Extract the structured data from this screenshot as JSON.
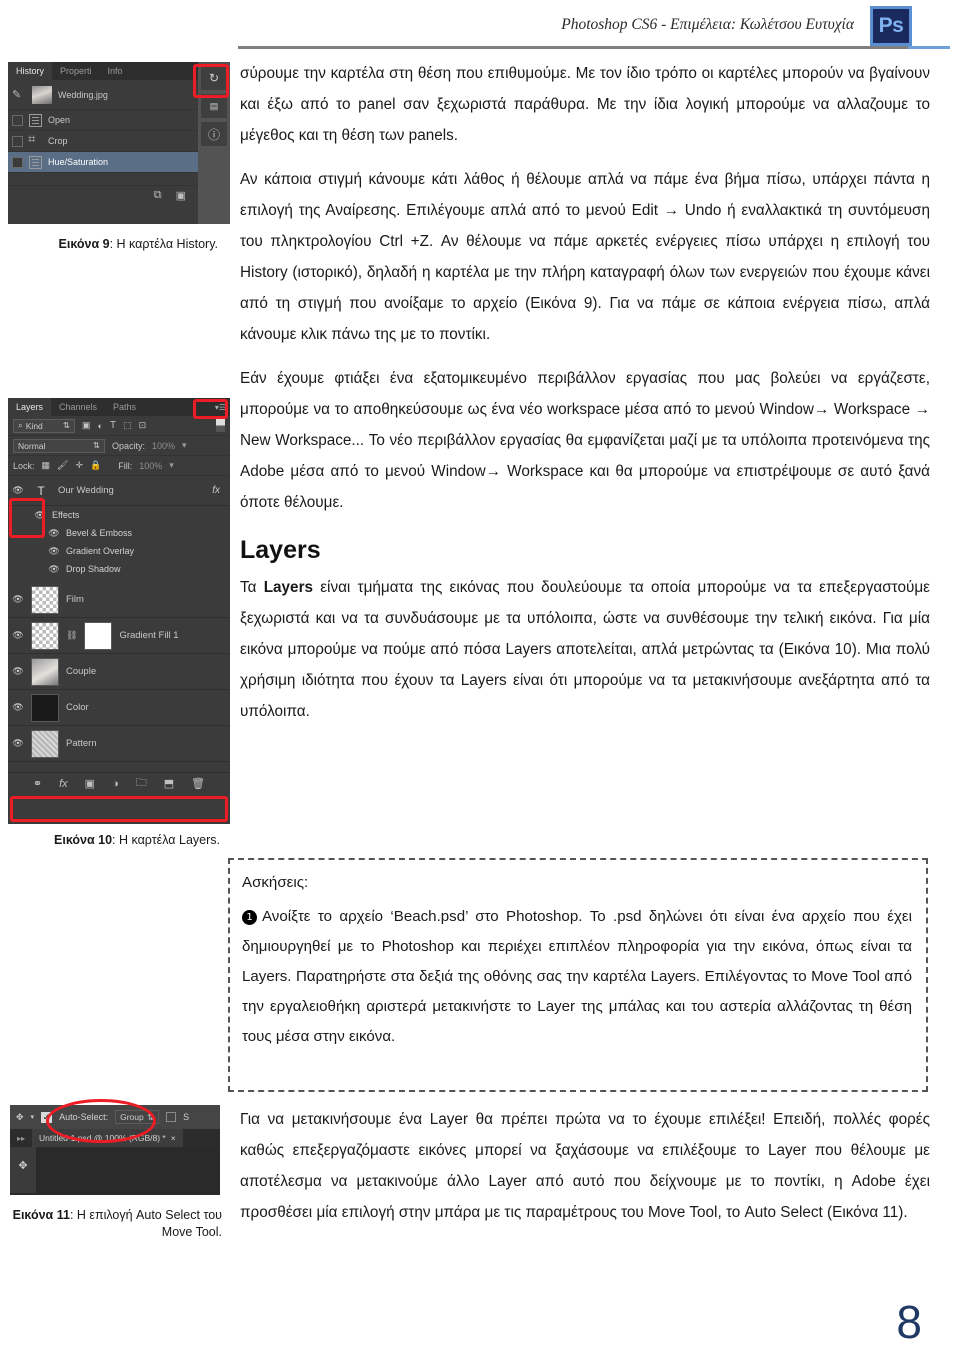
{
  "header": {
    "title": "Photoshop CS6 - Επιμέλεια: Κωλέτσου Ευτυχία",
    "logo_text": "Ps"
  },
  "page_number": "8",
  "main": {
    "paragraphs": [
      "σύρουμε την καρτέλα στη θέση που επιθυμούμε. Με τον ίδιο τρόπο οι καρτέλες μπορούν να βγαίνουν και έξω από το panel σαν ξεχωριστά παράθυρα. Με την ίδια λογική μπορούμε να αλλαζουμε το μέγεθος και τη θέση των panels.",
      "Αν κάποια στιγμή κάνουμε κάτι λάθος ή θέλουμε απλά να πάμε ένα βήμα πίσω, υπάρχει πάντα η επιλογή της Αναίρεσης. Επιλέγουμε απλά από το μενού Edit → Undo ή εναλλακτικά τη συντόμευση του πληκτρολογίου Ctrl +Z. Αν θέλουμε να πάμε αρκετές ενέργειες πίσω υπάρχει η επιλογή του History (ιστορικό), δηλαδή η καρτέλα με την πλήρη καταγραφή όλων των ενεργειών που έχουμε κάνει από τη στιγμή που ανοίξαμε το αρχείο (Εικόνα 9). Για να πάμε σε κάποια ενέργεια πίσω, απλά κάνουμε κλικ πάνω της με το ποντίκι.",
      "Εάν έχουμε φτιάξει ένα εξατομικευμένο περιβάλλον εργασίας που μας βολεύει να εργάζεστε, μπορούμε να το αποθηκεύσουμε ως ένα νέο workspace μέσα από το μενού Window→ Workspace → New Workspace... Το νέο περιβάλλον εργασίας θα εμφανίζεται μαζί με τα υπόλοιπα προτεινόμενα της Adobe μέσα από το μενού Window→ Workspace και θα μπορούμε να επιστρέψουμε σε αυτό ξανά όποτε θέλουμε."
    ],
    "layers_heading": "Layers",
    "layers_paragraph_pre": "Τα ",
    "layers_paragraph_bold": "Layers",
    "layers_paragraph_post": " είναι τμήματα της εικόνας που δουλεύουμε τα οποία μπορούμε να τα επεξεργαστούμε ξεχωριστά και να τα συνδυάσουμε με τα υπόλοιπα, ώστε να συνθέσουμε την τελική εικόνα. Για μία εικόνα μπορούμε να πούμε από πόσα Layers αποτελείται, απλά μετρώντας τα (Εικόνα 10). Μια πολύ χρήσιμη ιδιότητα που έχουν τα Layers είναι ότι μπορούμε να τα μετακινήσουμε ανεξάρτητα από τα υπόλοιπα.",
    "bottom_paragraph": "Για να μετακινήσουμε ένα Layer θα πρέπει πρώτα να το έχουμε επιλέξει! Επειδή, πολλές φορές καθώς επεξεργαζόμαστε εικόνες μπορεί να ξαχάσουμε να επιλέξουμε το Layer που θέλουμε με αποτέλεσμα να μετακινούμε άλλο Layer από αυτό που δείχνουμε με το ποντίκι, η Adobe έχει προσθέσει μία επιλογή στην μπάρα με τις παραμέτρους του Move Tool, το Auto Select (Εικόνα 11)."
  },
  "exercise": {
    "title": "Ασκήσεις:",
    "item_number": "❶",
    "item_text": "Ανοίξτε το αρχείο ‘Beach.psd’ στο Photoshop. Το .psd δηλώνει ότι είναι ένα αρχείο που έχει δημιουργηθεί με το Photoshop και περιέχει επιπλέον πληροφορία για την εικόνα, όπως είναι τα Layers. Παρατηρήστε στα δεξιά της οθόνης σας την καρτέλα Layers. Επιλέγοντας το Move Tool από την εργαλειοθήκη αριστερά μετακινήστε το Layer της μπάλας και του αστερία αλλάζοντας τη θέση τους μέσα στην εικόνα."
  },
  "figure9": {
    "tabs": [
      "History",
      "Properti",
      "Info"
    ],
    "rows": [
      {
        "label": "Wedding.jpg",
        "type": "thumb"
      },
      {
        "label": "Open",
        "type": "doc"
      },
      {
        "label": "Crop",
        "type": "crop"
      },
      {
        "label": "Hue/Saturation",
        "type": "doc",
        "selected": true
      }
    ],
    "footer_icons": [
      "new-snapshot-icon",
      "camera-icon",
      "trash-icon"
    ],
    "caption_bold": "Εικόνα 9",
    "caption_rest": ": Η καρτέλα History."
  },
  "figure10": {
    "tabs": [
      "Layers",
      "Channels",
      "Paths"
    ],
    "filter_label": "Kind",
    "filter_icons": [
      "image-icon",
      "adjustment-icon",
      "type-icon",
      "shape-icon",
      "smartobject-icon"
    ],
    "blend_mode": "Normal",
    "opacity_label": "Opacity:",
    "opacity_value": "100%",
    "lock_label": "Lock:",
    "fill_label": "Fill:",
    "fill_value": "100%",
    "layers": [
      {
        "name": "Our Wedding",
        "fx": "fx",
        "kind": "text"
      },
      {
        "name": "Film",
        "kind": "film"
      },
      {
        "name": "Gradient Fill 1",
        "kind": "gradient"
      },
      {
        "name": "Couple",
        "kind": "photo"
      },
      {
        "name": "Color",
        "kind": "solid"
      },
      {
        "name": "Pattern",
        "kind": "pattern"
      }
    ],
    "effects": [
      {
        "name": "Effects",
        "level": 0
      },
      {
        "name": "Bevel & Emboss",
        "level": 1
      },
      {
        "name": "Gradient Overlay",
        "level": 1
      },
      {
        "name": "Drop Shadow",
        "level": 1
      }
    ],
    "bottom_icons": [
      "link-icon",
      "fx-icon",
      "mask-icon",
      "adjustment-icon",
      "group-icon",
      "new-layer-icon",
      "trash-icon"
    ],
    "caption_bold": "Εικόνα 10",
    "caption_rest": ": Η καρτέλα Layers."
  },
  "figure11": {
    "auto_select_label": "Auto-Select:",
    "group_value": "Group",
    "show_transform_label": "S",
    "doc_tab": "Untitled-1.psd @ 100% (RGB/8) *",
    "caption_bold": "Εικόνα 11",
    "caption_rest": ": Η επιλογή Auto Select του Move Tool."
  },
  "colors": {
    "accent_blue": "#1f3864",
    "highlight_red": "#ee1c25",
    "panel_bg": "#3b3b3b",
    "selected_row": "#5a6e86"
  }
}
